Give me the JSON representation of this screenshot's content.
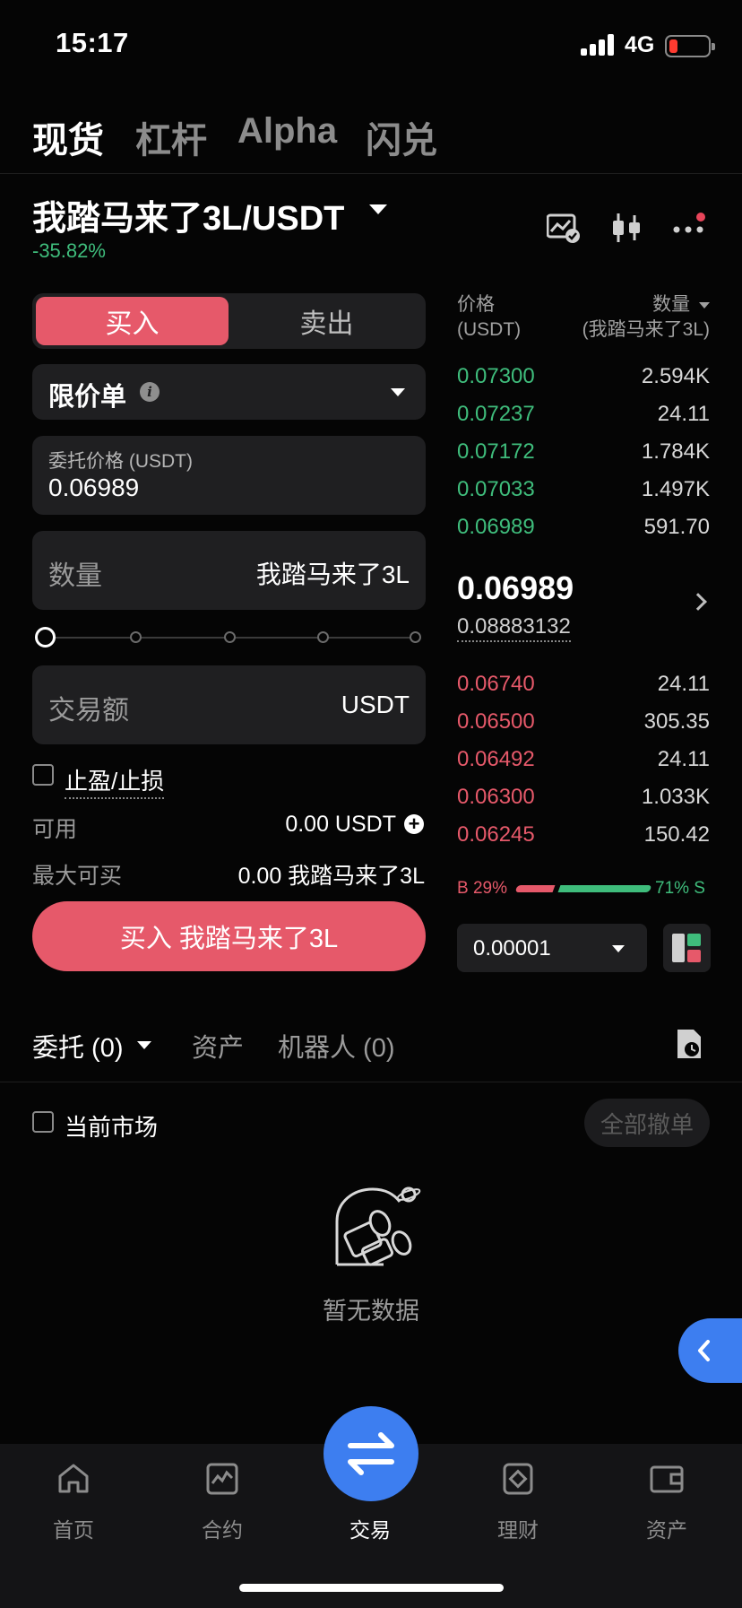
{
  "status_bar": {
    "time": "15:17",
    "network": "4G"
  },
  "top_tabs": [
    {
      "label": "现货",
      "active": true
    },
    {
      "label": "杠杆",
      "active": false
    },
    {
      "label": "Alpha",
      "active": false
    },
    {
      "label": "闪兑",
      "active": false
    }
  ],
  "pair": {
    "title": "我踏马来了3L/USDT",
    "change": "-35.82%"
  },
  "order_form": {
    "buy_label": "买入",
    "sell_label": "卖出",
    "order_type": "限价单",
    "price_label": "委托价格 (USDT)",
    "price_value": "0.06989",
    "qty_label": "数量",
    "qty_unit": "我踏马来了3L",
    "slider_percent": 0,
    "amount_label": "交易额",
    "amount_unit": "USDT",
    "tpsl_label": "止盈/止损",
    "available_label": "可用",
    "available_value": "0.00 USDT",
    "max_buy_label": "最大可买",
    "max_buy_value": "0.00 我踏马来了3L",
    "submit_label": "买入 我踏马来了3L"
  },
  "order_book": {
    "price_header": "价格",
    "price_unit": "(USDT)",
    "qty_header": "数量",
    "qty_unit": "(我踏马来了3L)",
    "asks": [
      {
        "price": "0.07300",
        "qty": "2.594K"
      },
      {
        "price": "0.07237",
        "qty": "24.11"
      },
      {
        "price": "0.07172",
        "qty": "1.784K"
      },
      {
        "price": "0.07033",
        "qty": "1.497K"
      },
      {
        "price": "0.06989",
        "qty": "591.70"
      }
    ],
    "last_price": "0.06989",
    "mark_price": "0.08883132",
    "bids": [
      {
        "price": "0.06740",
        "qty": "24.11"
      },
      {
        "price": "0.06500",
        "qty": "305.35"
      },
      {
        "price": "0.06492",
        "qty": "24.11"
      },
      {
        "price": "0.06300",
        "qty": "1.033K"
      },
      {
        "price": "0.06245",
        "qty": "150.42"
      }
    ],
    "buy_ratio": "B 29%",
    "sell_ratio": "71% S",
    "buy_ratio_value": 29,
    "precision": "0.00001"
  },
  "orders": {
    "tabs": [
      "委托 (0)",
      "资产",
      "机器人 (0)"
    ],
    "current_market_label": "当前市场",
    "cancel_all_label": "全部撤单",
    "empty_label": "暂无数据"
  },
  "bottom_nav": [
    {
      "label": "首页",
      "icon": "home-icon"
    },
    {
      "label": "合约",
      "icon": "chart-icon"
    },
    {
      "label": "交易",
      "icon": "swap-icon"
    },
    {
      "label": "理财",
      "icon": "finance-icon"
    },
    {
      "label": "资产",
      "icon": "wallet-icon"
    }
  ],
  "colors": {
    "buy": "#e6596a",
    "sell": "#3fbd7c",
    "accent": "#3d7ef0"
  }
}
